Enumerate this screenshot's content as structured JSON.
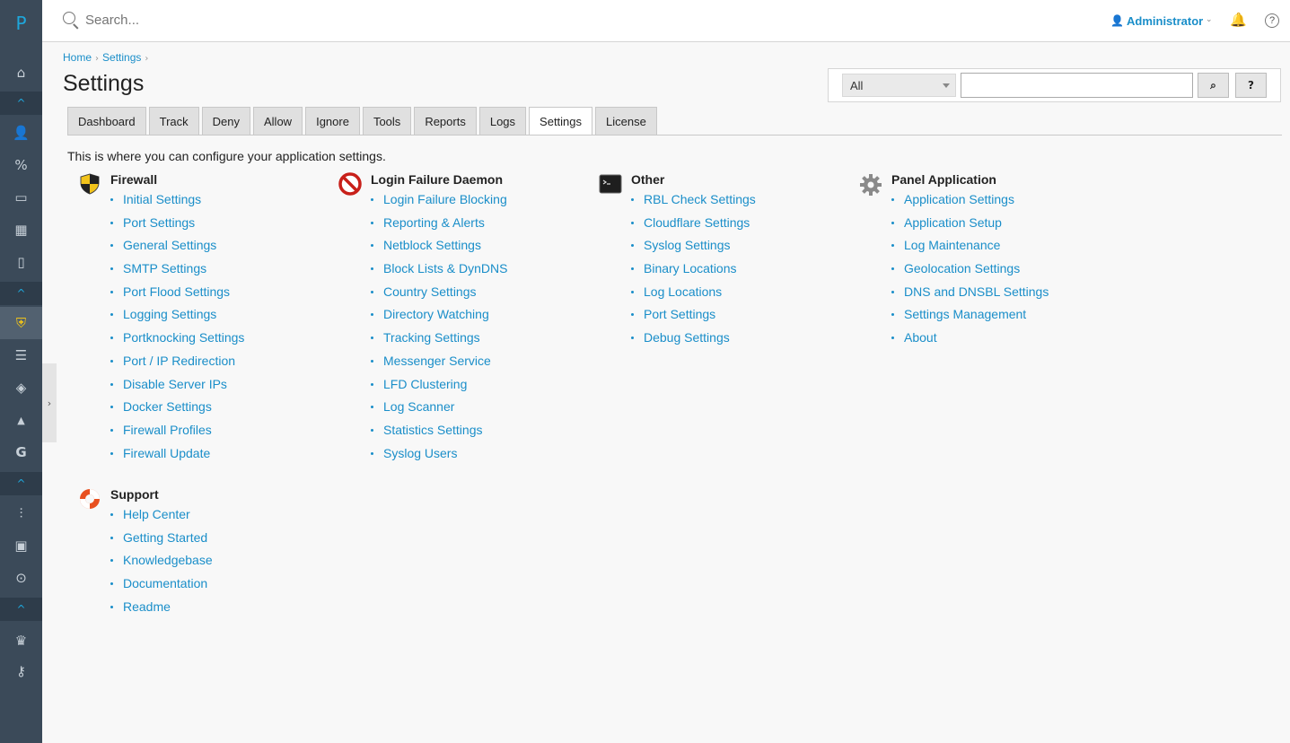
{
  "sidebar": {
    "logo": "P",
    "items": [
      {
        "icon": "home-icon",
        "glyph": "⌂"
      },
      {
        "icon": "collapse-icon",
        "glyph": "^"
      },
      {
        "icon": "user-icon",
        "glyph": "👤"
      },
      {
        "icon": "percent-icon",
        "glyph": "%"
      },
      {
        "icon": "monitor-icon",
        "glyph": "▭"
      },
      {
        "icon": "apps-grid-icon",
        "glyph": "▦"
      },
      {
        "icon": "book-icon",
        "glyph": "▯"
      },
      {
        "icon": "collapse-icon",
        "glyph": "^"
      },
      {
        "icon": "csf-shield-icon",
        "glyph": "⛨"
      },
      {
        "icon": "checklist-icon",
        "glyph": "☰"
      },
      {
        "icon": "shield-icon",
        "glyph": "◈"
      },
      {
        "icon": "mountain-icon",
        "glyph": "▲"
      },
      {
        "icon": "google-icon",
        "glyph": "G"
      },
      {
        "icon": "collapse-icon",
        "glyph": "^"
      },
      {
        "icon": "sliders-icon",
        "glyph": "⫶"
      },
      {
        "icon": "dashboard-icon",
        "glyph": "▣"
      },
      {
        "icon": "search-zoom-icon",
        "glyph": "⊙"
      },
      {
        "icon": "collapse-icon",
        "glyph": "^"
      },
      {
        "icon": "crown-icon",
        "glyph": "♛"
      },
      {
        "icon": "key-icon",
        "glyph": "⚷"
      }
    ],
    "toggle_glyph": "›"
  },
  "topbar": {
    "search_placeholder": "Search...",
    "user_label": "Administrator"
  },
  "breadcrumb": [
    "Home",
    "Settings"
  ],
  "page_title": "Settings",
  "filter": {
    "select_value": "All",
    "search_button": "⌕",
    "help_button": "?"
  },
  "tabs": [
    "Dashboard",
    "Track",
    "Deny",
    "Allow",
    "Ignore",
    "Tools",
    "Reports",
    "Logs",
    "Settings",
    "License"
  ],
  "active_tab": "Settings",
  "intro": "This is where you can configure your application settings.",
  "sections": {
    "firewall": {
      "title": "Firewall",
      "links": [
        "Initial Settings",
        "Port Settings",
        "General Settings",
        "SMTP Settings",
        "Port Flood Settings",
        "Logging Settings",
        "Portknocking Settings",
        "Port / IP Redirection",
        "Disable Server IPs",
        "Docker Settings",
        "Firewall Profiles",
        "Firewall Update"
      ]
    },
    "lfd": {
      "title": "Login Failure Daemon",
      "links": [
        "Login Failure Blocking",
        "Reporting & Alerts",
        "Netblock Settings",
        "Block Lists & DynDNS",
        "Country Settings",
        "Directory Watching",
        "Tracking Settings",
        "Messenger Service",
        "LFD Clustering",
        "Log Scanner",
        "Statistics Settings",
        "Syslog Users"
      ]
    },
    "other": {
      "title": "Other",
      "links": [
        "RBL Check Settings",
        "Cloudflare Settings",
        "Syslog Settings",
        "Binary Locations",
        "Log Locations",
        "Port Settings",
        "Debug Settings"
      ]
    },
    "panel": {
      "title": "Panel Application",
      "links": [
        "Application Settings",
        "Application Setup",
        "Log Maintenance",
        "Geolocation Settings",
        "DNS and DNSBL Settings",
        "Settings Management",
        "About"
      ]
    },
    "support": {
      "title": "Support",
      "links": [
        "Help Center",
        "Getting Started",
        "Knowledgebase",
        "Documentation",
        "Readme"
      ]
    }
  },
  "colors": {
    "sidebar_bg": "#3b4a59",
    "accent": "#1a8ec9",
    "page_bg": "#f8f8f8"
  }
}
